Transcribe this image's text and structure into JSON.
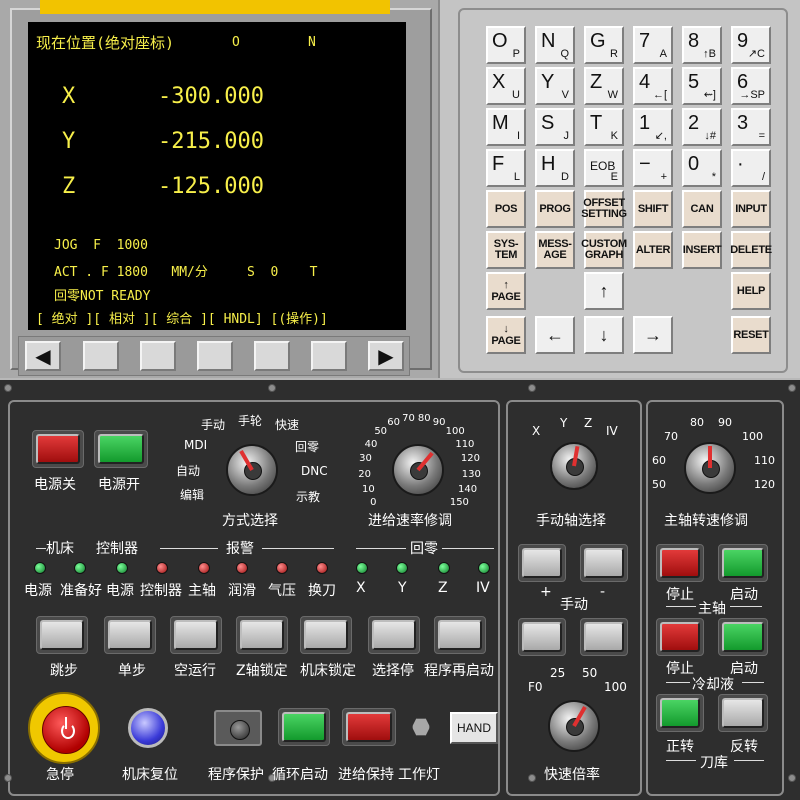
{
  "crt": {
    "title": "现在位置(绝对座标)",
    "o_label": "O",
    "n_label": "N",
    "axes": [
      {
        "axis": "X",
        "value": "-300.000"
      },
      {
        "axis": "Y",
        "value": "-215.000"
      },
      {
        "axis": "Z",
        "value": "-125.000"
      }
    ],
    "jog_line": "JOG  F  1000",
    "act_line": "ACT . F 1800   MM/分     S  0    T",
    "status_line": "回零NOT READY",
    "softkey_line": "[ 绝对 ][ 相对 ][ 综合 ][ HNDL] [(操作)]"
  },
  "soft_keys": {
    "left": "◀",
    "right": "▶"
  },
  "keypad": {
    "alpha": [
      {
        "main": "O",
        "sub": "P"
      },
      {
        "main": "N",
        "sub": "Q"
      },
      {
        "main": "G",
        "sub": "R"
      },
      {
        "main": "7",
        "sub": "A"
      },
      {
        "main": "8",
        "sub": "↑B"
      },
      {
        "main": "9",
        "sub": "↗C"
      },
      {
        "main": "X",
        "sub": "U"
      },
      {
        "main": "Y",
        "sub": "V"
      },
      {
        "main": "Z",
        "sub": "W"
      },
      {
        "main": "4",
        "sub": "←["
      },
      {
        "main": "5",
        "sub": "⇜]"
      },
      {
        "main": "6",
        "sub": "→SP"
      },
      {
        "main": "M",
        "sub": "I"
      },
      {
        "main": "S",
        "sub": "J"
      },
      {
        "main": "T",
        "sub": "K"
      },
      {
        "main": "1",
        "sub": "↙,"
      },
      {
        "main": "2",
        "sub": "↓#"
      },
      {
        "main": "3",
        "sub": "="
      },
      {
        "main": "F",
        "sub": "L"
      },
      {
        "main": "H",
        "sub": "D"
      },
      {
        "main": "EOB",
        "sub": "E"
      },
      {
        "main": "−",
        "sub": "+"
      },
      {
        "main": "0",
        "sub": "*"
      },
      {
        "main": "·",
        "sub": "/"
      }
    ],
    "func": [
      "POS",
      "PROG",
      "OFFSET SETTING",
      "SHIFT",
      "CAN",
      "INPUT",
      "SYS-TEM",
      "MESS-AGE",
      "CUSTOM GRAPH",
      "ALTER",
      "INSERT",
      "DELETE"
    ],
    "page_up": "↑\nPAGE",
    "page_down": "↓\nPAGE",
    "help": "HELP",
    "reset": "RESET",
    "arrow_up": "↑",
    "arrow_left": "←",
    "arrow_down": "↓",
    "arrow_right": "→"
  },
  "panel": {
    "power_off": "电源关",
    "power_on": "电源开",
    "mode_labels": [
      "手动",
      "手轮",
      "快速",
      "MDI",
      "回零",
      "自动",
      "DNC",
      "编辑",
      "示教"
    ],
    "mode_select": "方式选择",
    "feed_scale": [
      "0",
      "10",
      "20",
      "30",
      "40",
      "50",
      "60",
      "70",
      "80",
      "90",
      "100",
      "110",
      "120",
      "130",
      "140",
      "150"
    ],
    "feed_override": "进给速率修调",
    "axis_scale": [
      "X",
      "Y",
      "Z",
      "IV"
    ],
    "axis_select": "手动轴选择",
    "spindle_scale": [
      "50",
      "60",
      "70",
      "80",
      "90",
      "100",
      "110",
      "120"
    ],
    "spindle_override": "主轴转速修调",
    "group_machine": "机床",
    "group_controller": "控制器",
    "group_alarm": "报警",
    "group_home": "回零",
    "led_labels": [
      "电源",
      "准备好",
      "电源",
      "控制器",
      "主轴",
      "润滑",
      "气压",
      "换刀",
      "X",
      "Y",
      "Z",
      "IV"
    ],
    "plus": "+",
    "minus": "-",
    "manual": "手动",
    "func_buttons": [
      "跳步",
      "单步",
      "空运行",
      "Z轴锁定",
      "机床锁定",
      "选择停",
      "程序再启动"
    ],
    "rapid_scale": [
      "F0",
      "25",
      "50",
      "100"
    ],
    "rapid_override": "快速倍率",
    "spindle_stop": "停止",
    "spindle_start": "启动",
    "spindle_group": "主轴",
    "coolant_stop": "停止",
    "coolant_start": "启动",
    "coolant_group": "冷却液",
    "magazine_fwd": "正转",
    "magazine_rev": "反转",
    "magazine_group": "刀库",
    "estop": "急停",
    "machine_reset": "机床复位",
    "program_protect": "程序保护",
    "cycle_start": "循环启动",
    "feed_hold": "进给保持",
    "work_light": "工作灯",
    "hand": "HAND"
  }
}
